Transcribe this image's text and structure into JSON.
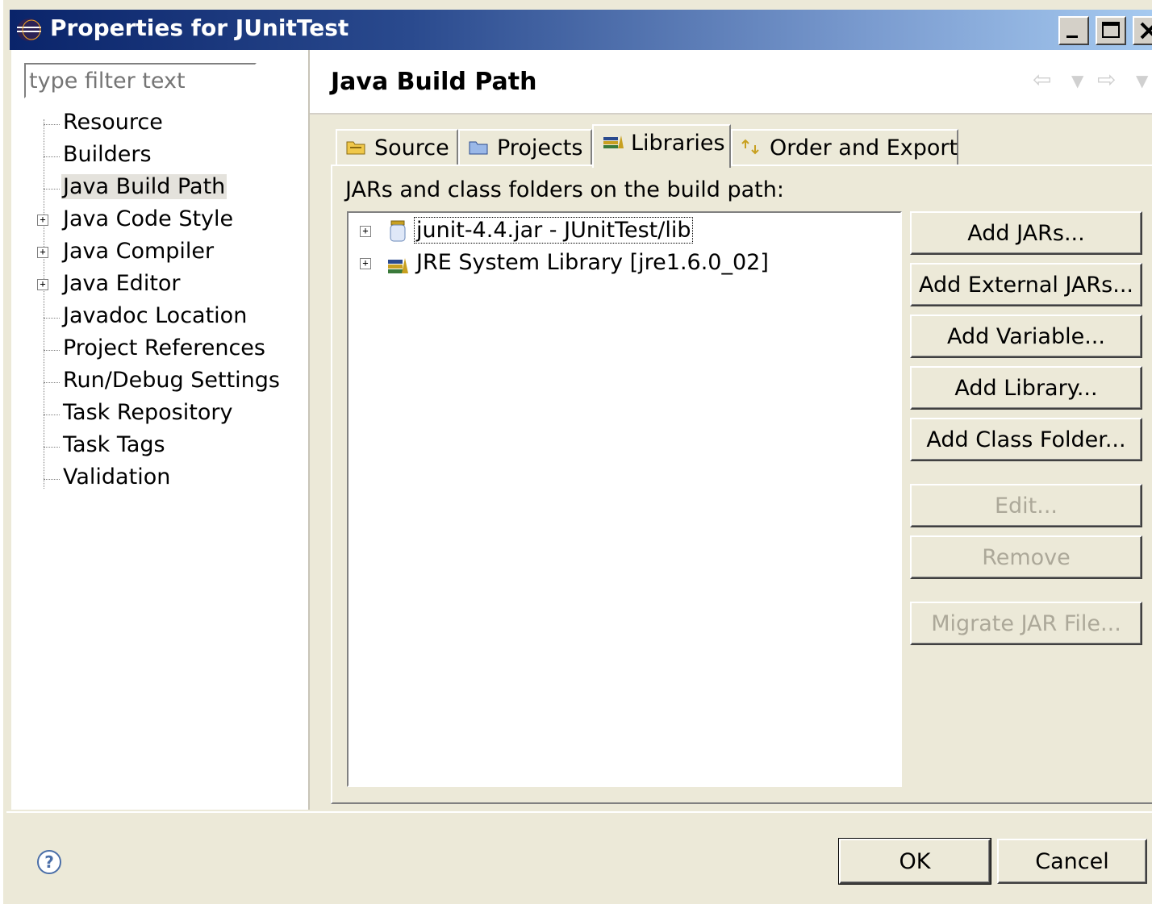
{
  "window": {
    "title": "Properties for JUnitTest"
  },
  "filter": {
    "placeholder": "type filter text"
  },
  "tree": {
    "items": [
      {
        "label": "Resource",
        "expandable": false
      },
      {
        "label": "Builders",
        "expandable": false
      },
      {
        "label": "Java Build Path",
        "expandable": false,
        "selected": true
      },
      {
        "label": "Java Code Style",
        "expandable": true
      },
      {
        "label": "Java Compiler",
        "expandable": true
      },
      {
        "label": "Java Editor",
        "expandable": true
      },
      {
        "label": "Javadoc Location",
        "expandable": false
      },
      {
        "label": "Project References",
        "expandable": false
      },
      {
        "label": "Run/Debug Settings",
        "expandable": false
      },
      {
        "label": "Task Repository",
        "expandable": false
      },
      {
        "label": "Task Tags",
        "expandable": false
      },
      {
        "label": "Validation",
        "expandable": false
      }
    ]
  },
  "page": {
    "title": "Java Build Path"
  },
  "tabs": [
    {
      "label": "Source",
      "icon": "source-folder-icon"
    },
    {
      "label": "Projects",
      "icon": "projects-folder-icon"
    },
    {
      "label": "Libraries",
      "icon": "libraries-icon",
      "active": true
    },
    {
      "label": "Order and Export",
      "icon": "order-export-icon"
    }
  ],
  "libraries": {
    "label": "JARs and class folders on the build path:",
    "entries": [
      {
        "label": "junit-4.4.jar - JUnitTest/lib",
        "icon": "jar-icon"
      },
      {
        "label": "JRE System Library [jre1.6.0_02]",
        "icon": "library-icon"
      }
    ]
  },
  "buttons": {
    "add_jars": "Add JARs...",
    "add_external_jars": "Add External JARs...",
    "add_variable": "Add Variable...",
    "add_library": "Add Library...",
    "add_class_folder": "Add Class Folder...",
    "edit": "Edit...",
    "remove": "Remove",
    "migrate_jar": "Migrate JAR File..."
  },
  "footer": {
    "ok": "OK",
    "cancel": "Cancel",
    "help_icon": "?"
  },
  "colors": {
    "titlebar_start": "#0a246a",
    "titlebar_end": "#a6caf0",
    "dialog_bg": "#ece9d8",
    "disabled_text": "#aca899"
  }
}
